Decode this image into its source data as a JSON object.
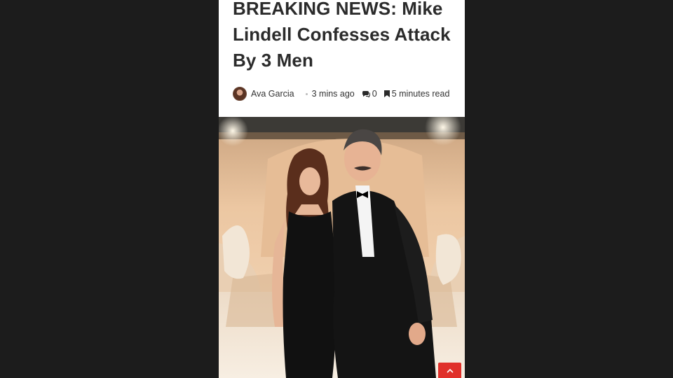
{
  "article": {
    "title": "BREAKING NEWS: Mike Lindell Confesses Attack By 3 Men",
    "author": "Ava Garcia",
    "time_ago": "3 mins ago",
    "comment_count": "0",
    "read_time": "5 minutes read"
  },
  "icons": {
    "comment": "comment-icon",
    "bookmark": "bookmark-icon",
    "scroll_top": "chevron-up-icon"
  },
  "colors": {
    "background": "#1c1c1c",
    "page": "#ffffff",
    "title": "#2b2b2b",
    "accent": "#e0302a"
  }
}
